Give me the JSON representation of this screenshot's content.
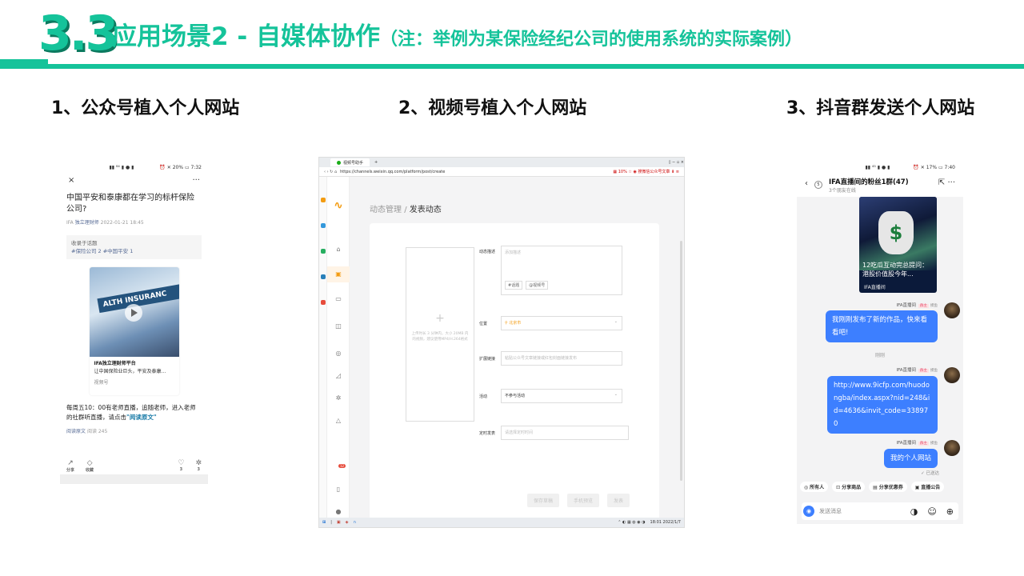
{
  "header": {
    "section_number": "3.3",
    "title": "应用场景2 - 自媒体协作",
    "note": "（注：举例为某保险经纪公司的使用系统的实际案例）"
  },
  "colors": {
    "accent": "#15c39a",
    "bubble": "#3d7fff",
    "link": "#576b95"
  },
  "captions": {
    "c1": "1、公众号植入个人网站",
    "c2": "2、视频号植入个人网站",
    "c3": "3、抖音群发送个人网站"
  },
  "phone1": {
    "status_left": "▮▮ ⁸⁴ ▮ ● ▮",
    "status_right": "⏰ ✕ 20% ▭ 7:32",
    "close": "×",
    "more": "···",
    "article_title": "中国平安和泰康都在学习的标杆保险公司?",
    "source": "IFA",
    "account": "独立理财师",
    "date": "2022-01-21 18:45",
    "topic_label": "收录于话题",
    "topic_tags": "#保险公司 2   #中国平安 1",
    "video_band": "ALTH INSURANC",
    "video_author": "IFA独立理财师平台",
    "video_desc": "让中国保险业巨头，平安及泰康...",
    "video_label": "视频号",
    "body_text": "每周五10：00有老师直播，追随老师，进入老师的社群听直播，请点击",
    "read_link": "\"阅读原文\"",
    "read_orig": "阅读原文",
    "read_count": "阅读 245",
    "action_share": "分享",
    "action_collect": "收藏",
    "action_like": "3",
    "action_watch": "3"
  },
  "browser": {
    "tab_title": "视频号助手",
    "tab_add": "+",
    "window_ctrls": "▯ − ▫ ×",
    "url": "https://channels.weixin.qq.com/platform/post/create",
    "addr_right": "▦ 10%  ☆  ◉ 搜微信公众号文章  ⬇  ≡",
    "nav_back": "‹ › ↻ ⌂",
    "crumb_parent": "动态管理",
    "crumb_sep": "/",
    "crumb_current": "发表动态",
    "upload_plus": "+",
    "upload_desc": "上传时长 3 分钟内，大小 20MB 内的视频，建议使用MP4/H.264格式",
    "labels": {
      "desc": "动态描述",
      "location": "位置",
      "link": "扩展链接",
      "activity": "活动",
      "schedule": "定时发表"
    },
    "desc_placeholder": "添加描述",
    "tag_topic": "#话题",
    "tag_mention": "@视频号",
    "location_value": "北京市",
    "link_placeholder": "粘贴公众号文章链接或红包封面链接发布",
    "activity_value": "不参与活动",
    "schedule_placeholder": "请选择定时时间",
    "btn_save": "保存草稿",
    "btn_preview": "手机预览",
    "btn_publish": "发表",
    "notif_count": "12",
    "taskbar_time": "18:01\n2022/1/7"
  },
  "phone3": {
    "status_left": "▮▮ ⁴⁵ ▮ ● ▮",
    "status_right": "⏰ ✕ 17% ▭ 7:40",
    "back": "‹",
    "badge_count": "5",
    "group_name": "IFA直播间的粉丝1群(47)",
    "online": "3个朋友在线",
    "tools": "⇱ ···",
    "card_overlay": "12吃瓜互动完总提问：港股价值股今年...",
    "card_tag": "IFA直播间",
    "sender": "IFA直播间",
    "sender_badge": "群主",
    "sender_role": "摸鱼",
    "msg1": "我刚刚发布了新的作品，快来看看吧!",
    "time1": "刚刚",
    "msg2": "http://www.9icfp.com/huodongba/index.aspx?nid=248&id=4636&invit_code=338970",
    "msg3": "我的个人网站",
    "sent": "已送达",
    "quick": [
      "所有人",
      "分享商品",
      "分享优惠券",
      "直播公告"
    ],
    "input_placeholder": "发送消息"
  }
}
